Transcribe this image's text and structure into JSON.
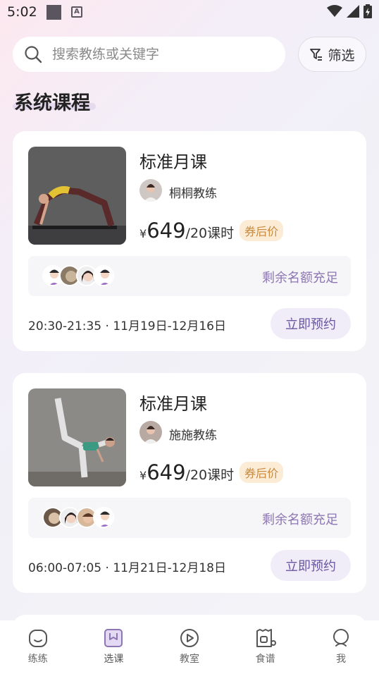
{
  "status_bar": {
    "time": "5:02"
  },
  "search": {
    "placeholder": "搜索教练或关键字"
  },
  "filter": {
    "label": "筛选"
  },
  "section": {
    "title": "系统课程"
  },
  "courses": [
    {
      "title": "标准月课",
      "coach": "桐桐教练",
      "price_symbol": "¥",
      "price": "649",
      "unit": "/20课时",
      "badge": "券后价",
      "seats": "剩余名额充足",
      "schedule": "20:30-21:35 · 11月19日-12月16日",
      "book_label": "立即预约"
    },
    {
      "title": "标准月课",
      "coach": "施施教练",
      "price_symbol": "¥",
      "price": "649",
      "unit": "/20课时",
      "badge": "券后价",
      "seats": "剩余名额充足",
      "schedule": "06:00-07:05 · 11月21日-12月18日",
      "book_label": "立即预约"
    }
  ],
  "tabbar": {
    "items": [
      {
        "label": "练练",
        "icon": "practice-icon"
      },
      {
        "label": "选课",
        "icon": "course-select-icon",
        "active": true
      },
      {
        "label": "教室",
        "icon": "classroom-play-icon"
      },
      {
        "label": "食谱",
        "icon": "recipe-icon"
      },
      {
        "label": "我",
        "icon": "profile-icon"
      }
    ]
  },
  "colors": {
    "accent": "#8d76b3",
    "badge_bg": "#fcebd5",
    "badge_text": "#c78a3f"
  }
}
